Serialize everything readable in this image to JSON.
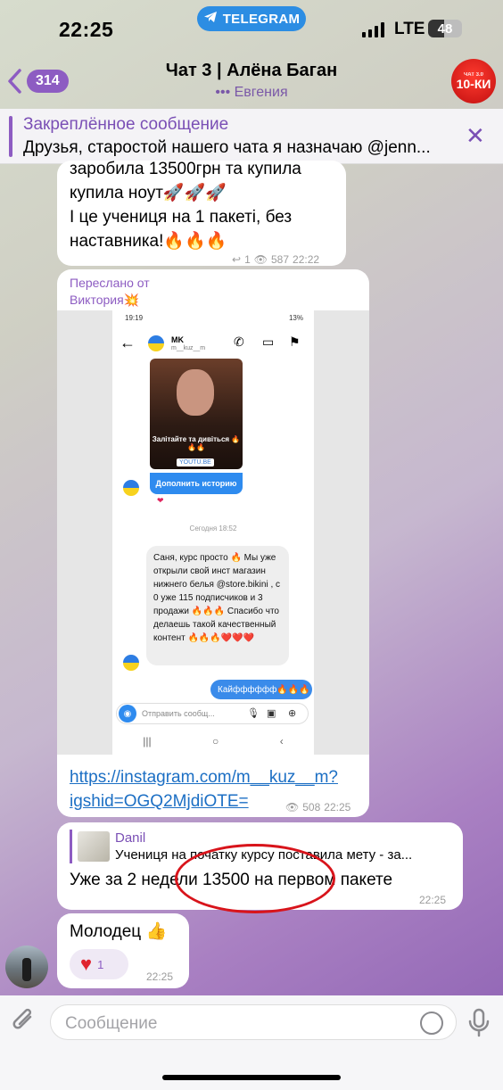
{
  "status_bar": {
    "time": "22:25",
    "app_pill": "TELEGRAM",
    "network": "LTE",
    "battery": "48",
    "battery_level": 0.48
  },
  "header": {
    "back_count": "314",
    "title": "Чат 3 | Алёна Баган",
    "subtitle": "••• Евгения",
    "avatar_text": "10-КИ",
    "avatar_small": "ЧАТ 3.0"
  },
  "pinned": {
    "title": "Закреплённое сообщение",
    "text": "Друзья, старостой нашего чата я назначаю @jenn..."
  },
  "messages": {
    "m1": {
      "lines": [
        "заробила 13500грн та купила",
        "купила ноут🚀🚀🚀",
        "І це учениця на 1 пакеті, без",
        "наставника!🔥🔥🔥"
      ],
      "replies": "1",
      "views": "587",
      "time": "22:22"
    },
    "m2": {
      "forwarded_label": "Переслано от",
      "forwarded_name": "Виктория💥",
      "shot": {
        "time": "19:19",
        "battery": "13%",
        "name": "MK",
        "user": "m__kuz__m",
        "video_caption": "Залітайте та дивіться 🔥🔥🔥",
        "video_link": "YOUTU.BE",
        "story_button": "Дополнить историю",
        "date": "Сегодня 18:52",
        "message": "Саня, курс просто 🔥 Мы уже открыли свой инст магазин нижнего белья @store.bikini , с 0 уже 115 подписчиков и 3 продажи 🔥🔥🔥 Спасибо что делаешь такой качественный контент 🔥🔥🔥❤️❤️❤️",
        "reply": "Кайфффффф🔥🔥🔥",
        "input_placeholder": "Отправить сообщ..."
      },
      "link": "https://instagram.com/m__kuz__m?igshid=OGQ2MjdiOTE=",
      "views": "508",
      "time": "22:25"
    },
    "m3": {
      "reply_name": "Danil",
      "reply_text": "Учениця на початку курсу поставила мету - за...",
      "text": "Уже за 2 недели 13500 на первом пакете",
      "time": "22:25"
    },
    "m4": {
      "text": "Молодец 👍",
      "reaction_count": "1",
      "time": "22:25"
    }
  },
  "input": {
    "placeholder": "Сообщение"
  },
  "colors": {
    "accent": "#8d5cc2",
    "link": "#1c6fc4",
    "annotation": "#d8141b",
    "telegram_blue": "#2c8de3"
  }
}
